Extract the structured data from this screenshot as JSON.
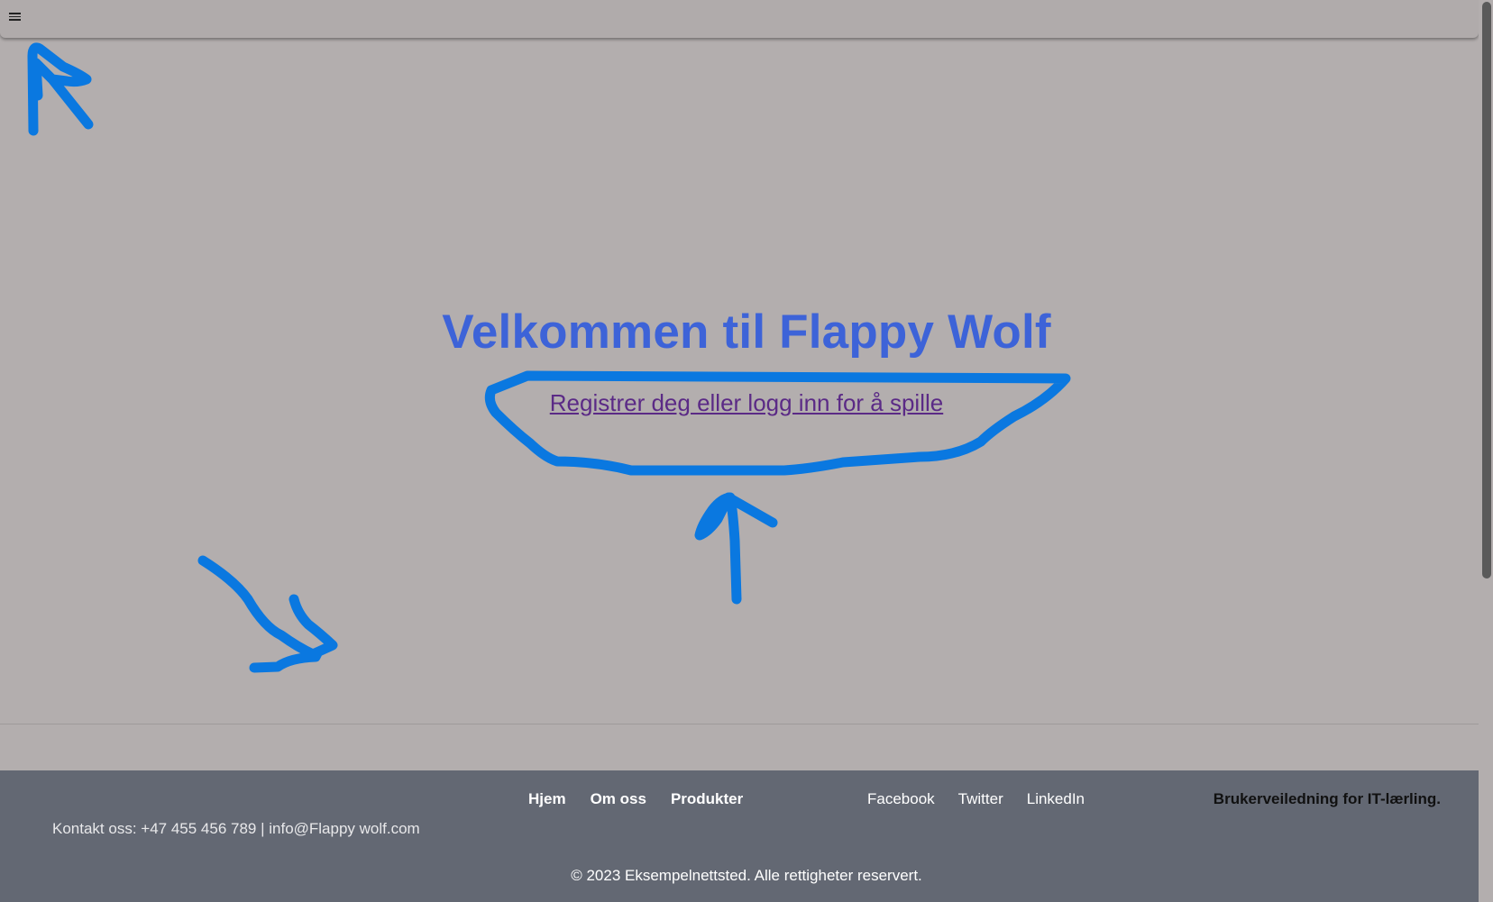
{
  "topbar": {
    "menu_icon": "hamburger-menu-icon"
  },
  "hero": {
    "title": "Velkommen til Flappy Wolf",
    "link_text": "Registrer deg eller logg inn for å spille"
  },
  "footer": {
    "nav": [
      "Hjem",
      "Om oss",
      "Produkter"
    ],
    "social": [
      "Facebook",
      "Twitter",
      "LinkedIn"
    ],
    "guide": "Brukerveiledning for IT-lærling.",
    "contact": "Kontakt oss: +47 455 456 789 | info@Flappy wolf.com",
    "copyright": "© 2023 Eksempelnettsted. Alle rettigheter reservert."
  },
  "colors": {
    "background": "#b3aeae",
    "title": "#3d63d8",
    "link": "#5b2a86",
    "footer": "#636873",
    "annotation": "#0a78e0"
  }
}
